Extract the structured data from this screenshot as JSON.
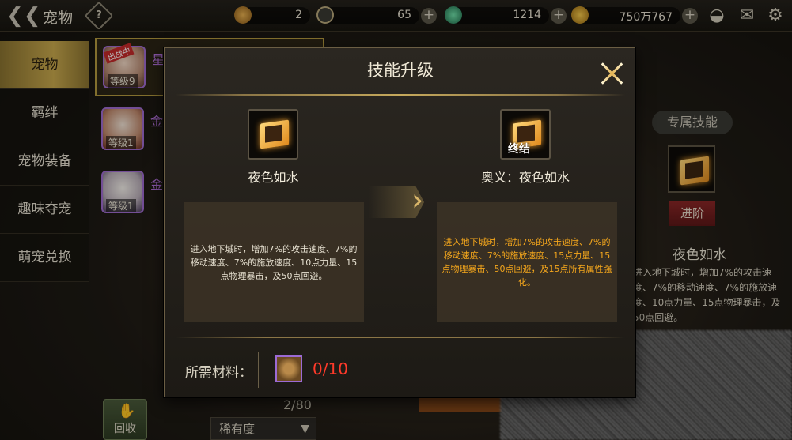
{
  "top": {
    "title": "宠物",
    "help": "?",
    "resources": [
      {
        "name": "coin-icon",
        "value": "2"
      },
      {
        "name": "stamina-icon",
        "value": "65"
      },
      {
        "name": "gem-icon",
        "value": "1214"
      },
      {
        "name": "gold-icon",
        "value": "750万767"
      }
    ]
  },
  "sidebar": {
    "items": [
      {
        "label": "宠物",
        "active": true
      },
      {
        "label": "羁绊"
      },
      {
        "label": "宠物装备"
      },
      {
        "label": "趣味夺宠"
      },
      {
        "label": "萌宠兑换"
      }
    ]
  },
  "pets": [
    {
      "name": "星",
      "level": "等级9",
      "badge": "出战中"
    },
    {
      "name": "金",
      "level": "等级1"
    },
    {
      "name": "金",
      "level": "等级1"
    }
  ],
  "right_panel": {
    "exclusive_label": "专属技能",
    "advance_label": "进阶",
    "skill_name": "夜色如水",
    "desc": "进入地下城时，增加7%的攻击速度、7%的移动速度、7%的施放速度、10点力量、15点物理暴击，及50点回避。"
  },
  "bottom": {
    "recycle_label": "回收",
    "count": "2/80",
    "rarity_label": "稀有度"
  },
  "modal": {
    "title": "技能升级",
    "current": {
      "name": "夜色如水",
      "desc": "进入地下城时，增加7%的攻击速度、7%的移动速度、7%的施放速度、10点力量、15点物理暴击，及50点回避。"
    },
    "next": {
      "name": "奥义：夜色如水",
      "badge": "终结",
      "desc": "进入地下城时，增加7%的攻击速度、7%的移动速度、7%的施放速度、15点力量、15点物理暴击、50点回避，及15点所有属性强化。"
    },
    "material_label": "所需材料：",
    "material_count": "0/10"
  }
}
